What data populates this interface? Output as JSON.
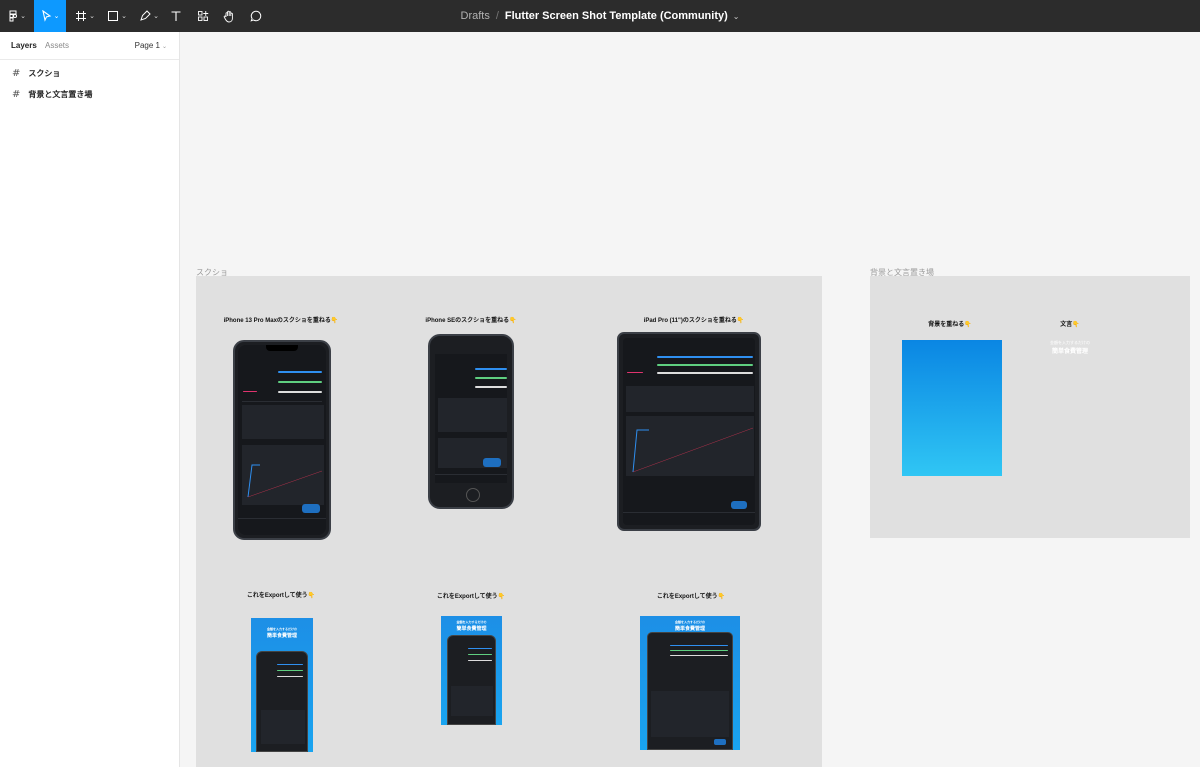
{
  "toolbar": {
    "tools": [
      {
        "name": "main-menu",
        "icon": "figma-logo-icon"
      },
      {
        "name": "move-tool",
        "icon": "cursor-icon"
      },
      {
        "name": "frame-tool",
        "icon": "frame-hash-icon"
      },
      {
        "name": "shape-tool",
        "icon": "rectangle-icon"
      },
      {
        "name": "pen-tool",
        "icon": "pen-icon"
      },
      {
        "name": "text-tool",
        "icon": "text-t-icon"
      },
      {
        "name": "resources-tool",
        "icon": "resources-icon"
      },
      {
        "name": "hand-tool",
        "icon": "hand-icon"
      },
      {
        "name": "comment-tool",
        "icon": "comment-icon"
      }
    ],
    "breadcrumb": "Drafts",
    "separator": "/",
    "file_name": "Flutter Screen Shot Template (Community)",
    "accent": "#0d99ff",
    "background": "#2c2c2c"
  },
  "left_panel": {
    "tabs": {
      "layers": "Layers",
      "assets": "Assets"
    },
    "page_selector": "Page 1",
    "layers": [
      {
        "label": "スクショ",
        "icon": "frame-hash-icon"
      },
      {
        "label": "背景と文言置き場",
        "icon": "frame-hash-icon"
      }
    ]
  },
  "canvas": {
    "frame1": {
      "label": "スクショ",
      "titles": {
        "iphone13": "iPhone 13 Pro Maxのスクショを重ねる👇",
        "iphonese": "iPhone SEのスクショを重ねる👇",
        "ipad": "iPad Pro (11\")のスクショを重ねる👇",
        "export1": "これをExportして使う👇",
        "export2": "これをExportして使う👇",
        "export3": "これをExportして使う👇"
      },
      "export_caption_top": "金額を入力するだけの",
      "export_caption_main": "簡単食費管理"
    },
    "frame2": {
      "label": "背景と文言置き場",
      "titles": {
        "background": "背景を重ねる👇",
        "text": "文言👇"
      },
      "text_top": "金額を入力するだけの",
      "text_main": "簡単食費管理",
      "gradient_top": "#0a86e3",
      "gradient_bottom": "#30c6f4"
    }
  }
}
